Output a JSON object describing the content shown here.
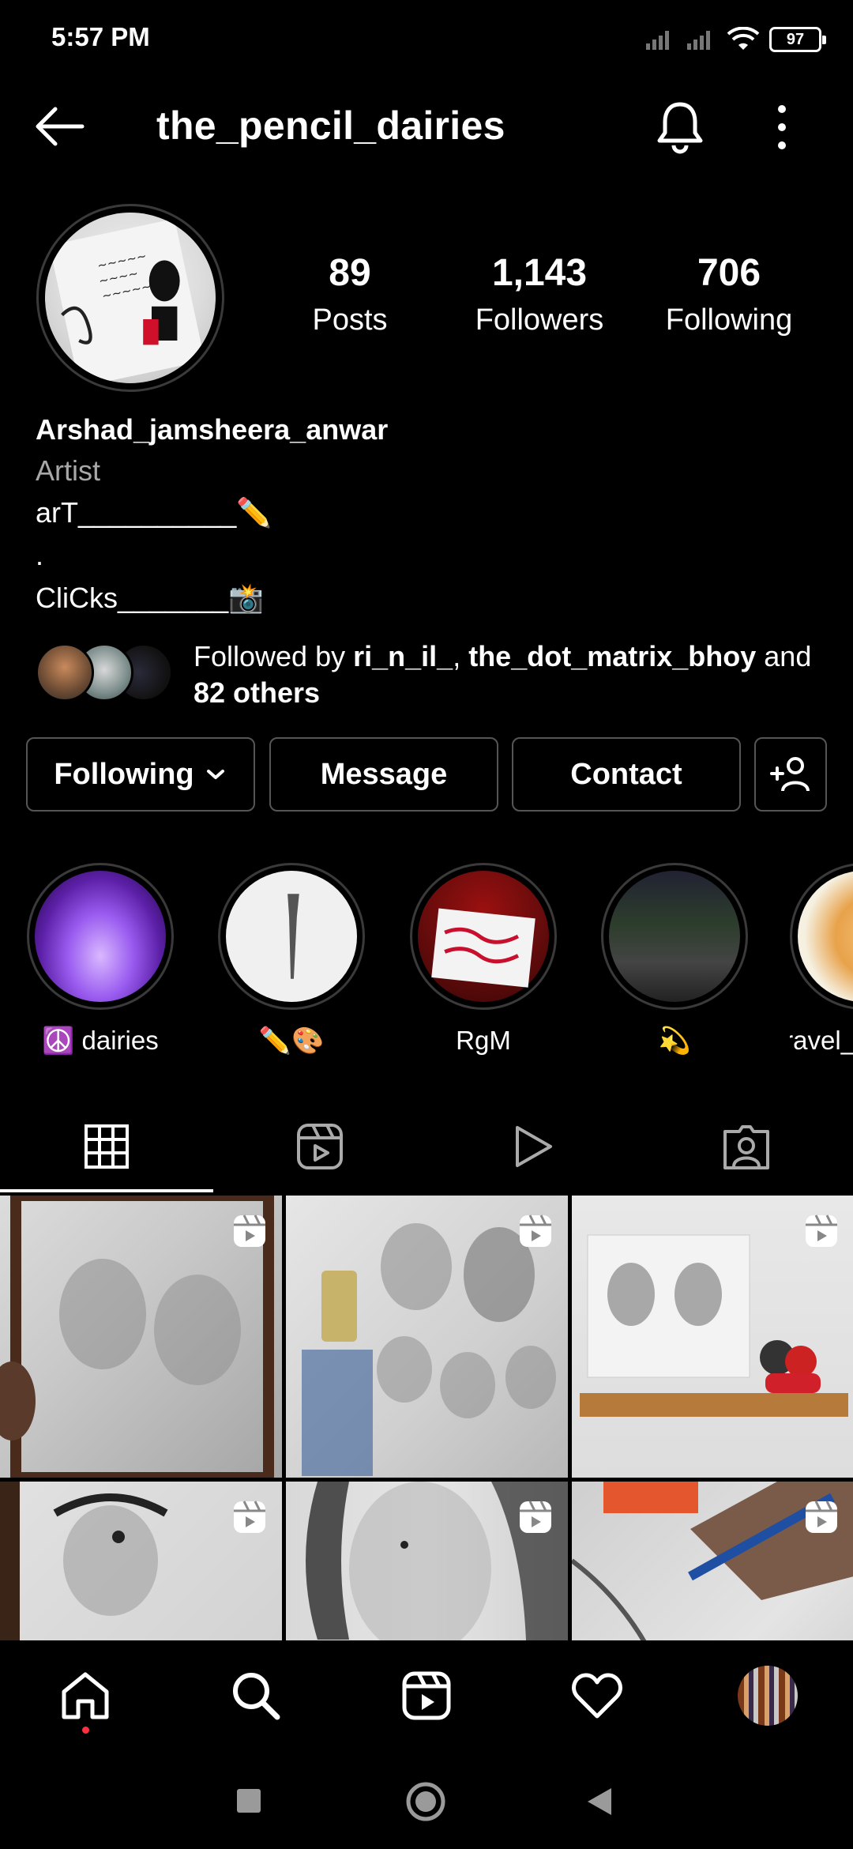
{
  "status_bar": {
    "time": "5:57 PM",
    "battery": "97"
  },
  "header": {
    "username": "the_pencil_dairies"
  },
  "stats": {
    "posts": {
      "count": "89",
      "label": "Posts"
    },
    "followers": {
      "count": "1,143",
      "label": "Followers"
    },
    "following": {
      "count": "706",
      "label": "Following"
    }
  },
  "bio": {
    "name": "Arshad_jamsheera_anwar",
    "category": "Artist",
    "lines": [
      "arT__________✏️",
      ".",
      "CliCks_______📸"
    ]
  },
  "followed_by": {
    "prefix": "Followed by ",
    "user1": "ri_n_il_",
    "sep": ", ",
    "user2": "the_dot_matrix_bhoy",
    "and": " and",
    "others": "82 others"
  },
  "buttons": {
    "following": "Following",
    "message": "Message",
    "contact": "Contact"
  },
  "highlights": [
    {
      "label": "☮️ dairies"
    },
    {
      "label": "✏️🎨"
    },
    {
      "label": "RgM"
    },
    {
      "label": "💫"
    },
    {
      "label": "travel_"
    }
  ],
  "colors": {
    "background": "#000000",
    "secondary_text": "#a8a8a8",
    "border": "#555555",
    "notification_dot": "#ff3040"
  },
  "icons": {
    "header": [
      "back-arrow-icon",
      "bell-icon",
      "more-vertical-icon"
    ],
    "tabs": [
      "grid-icon",
      "reels-icon",
      "play-icon",
      "tagged-icon"
    ],
    "bottom_nav": [
      "home-icon",
      "search-icon",
      "reels-icon",
      "heart-icon",
      "profile-avatar"
    ],
    "system_nav": [
      "recents-icon",
      "home-circle-icon",
      "back-triangle-icon"
    ]
  }
}
